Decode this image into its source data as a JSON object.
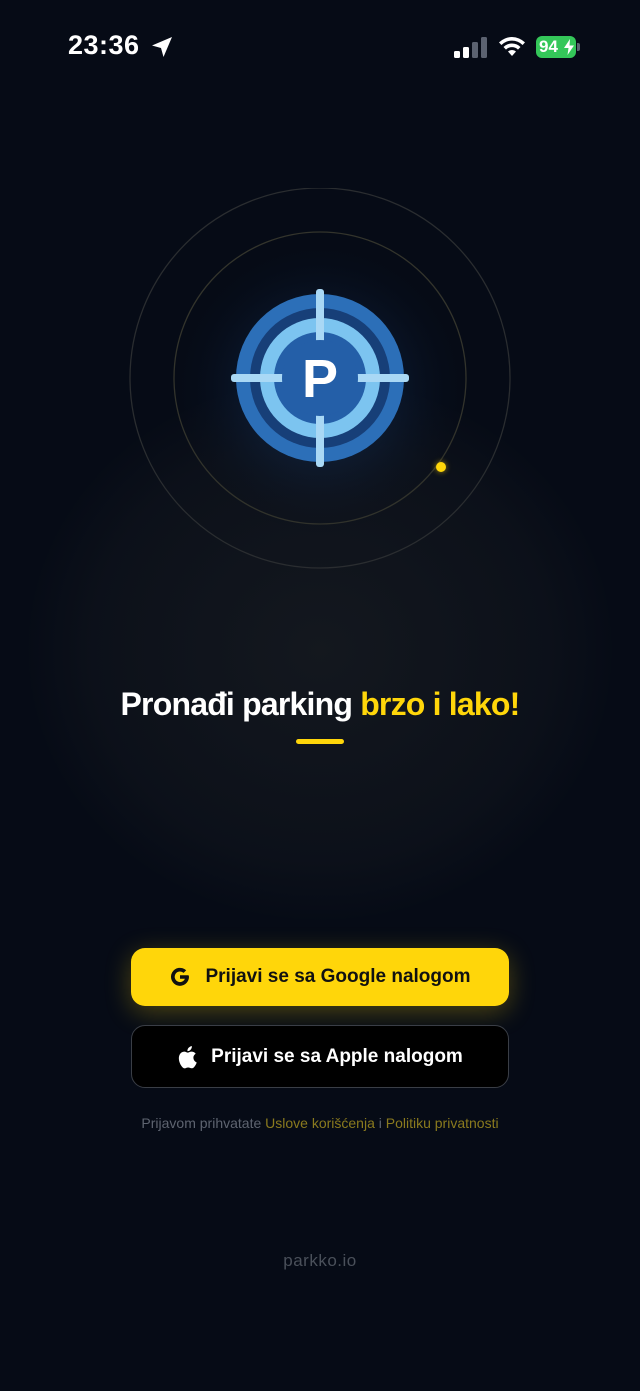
{
  "status_bar": {
    "time": "23:36",
    "battery": "94",
    "icons": [
      "location-arrow-icon",
      "cellular-signal-icon",
      "wifi-icon",
      "battery-charging-icon"
    ]
  },
  "logo": {
    "letter": "P",
    "icon": "parking-target-logo",
    "colors": {
      "outer": "#2c6fb8",
      "inner": "#7cc4f0",
      "core": "#245fa8",
      "crosshair": "#a9d8f5"
    }
  },
  "headline": {
    "part1": "Pronađi parking ",
    "part2": "brzo i lako!"
  },
  "buttons": {
    "google_label": "Prijavi se sa Google nalogom",
    "google_icon": "google-icon",
    "apple_label": "Prijavi se sa Apple nalogom",
    "apple_icon": "apple-icon"
  },
  "legal": {
    "prefix": "Prijavom prihvatate ",
    "terms_link": "Uslove korišćenja",
    "connector": " i ",
    "privacy_link": "Politiku privatnosti"
  },
  "footer": {
    "brand": "parkko.io"
  },
  "colors": {
    "accent": "#ffd60a",
    "background": "#060b16",
    "battery": "#34c759"
  }
}
